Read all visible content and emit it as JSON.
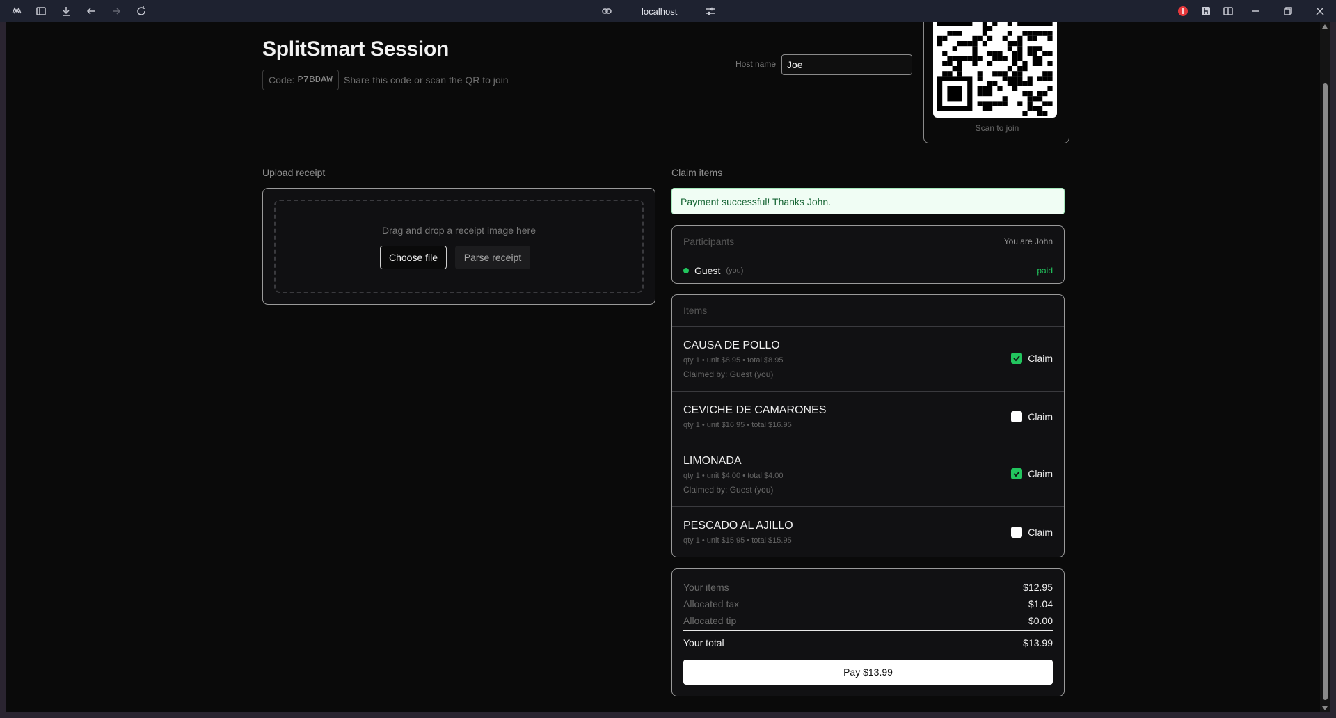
{
  "browser": {
    "url": "localhost"
  },
  "header": {
    "title": "SplitSmart Session",
    "code_label": "Code:",
    "code_value": "P7BDAW",
    "code_hint": "Share this code or scan the QR to join",
    "host_label": "Host name",
    "host_value": "Joe",
    "qr_caption": "Scan to join"
  },
  "upload": {
    "section_label": "Upload receipt",
    "drop_text": "Drag and drop a receipt image here",
    "choose_label": "Choose file",
    "parse_label": "Parse receipt"
  },
  "claim": {
    "section_label": "Claim items",
    "success_message": "Payment successful! Thanks John.",
    "participants": {
      "heading": "Participants",
      "you_are": "You are John",
      "list": [
        {
          "name": "Guest",
          "tag": "(you)",
          "status": "paid"
        }
      ]
    },
    "items_heading": "Items",
    "claim_label": "Claim",
    "items": [
      {
        "name": "CAUSA DE POLLO",
        "meta": "qty 1 • unit $8.95 • total $8.95",
        "claimed_by": "Claimed by: Guest (you)",
        "checked": true
      },
      {
        "name": "CEVICHE DE CAMARONES",
        "meta": "qty 1 • unit $16.95 • total $16.95",
        "claimed_by": "",
        "checked": false
      },
      {
        "name": "LIMONADA",
        "meta": "qty 1 • unit $4.00 • total $4.00",
        "claimed_by": "Claimed by: Guest (you)",
        "checked": true
      },
      {
        "name": "PESCADO AL AJILLO",
        "meta": "qty 1 • unit $15.95 • total $15.95",
        "claimed_by": "",
        "checked": false
      }
    ]
  },
  "summary": {
    "your_items_label": "Your items",
    "your_items_value": "$12.95",
    "tax_label": "Allocated tax",
    "tax_value": "$1.04",
    "tip_label": "Allocated tip",
    "tip_value": "$0.00",
    "total_label": "Your total",
    "total_value": "$13.99",
    "pay_label": "Pay $13.99"
  },
  "colors": {
    "accent_green": "#22c55e",
    "success_bg": "#f0fdf4",
    "page_bg": "#0a0a0a"
  }
}
